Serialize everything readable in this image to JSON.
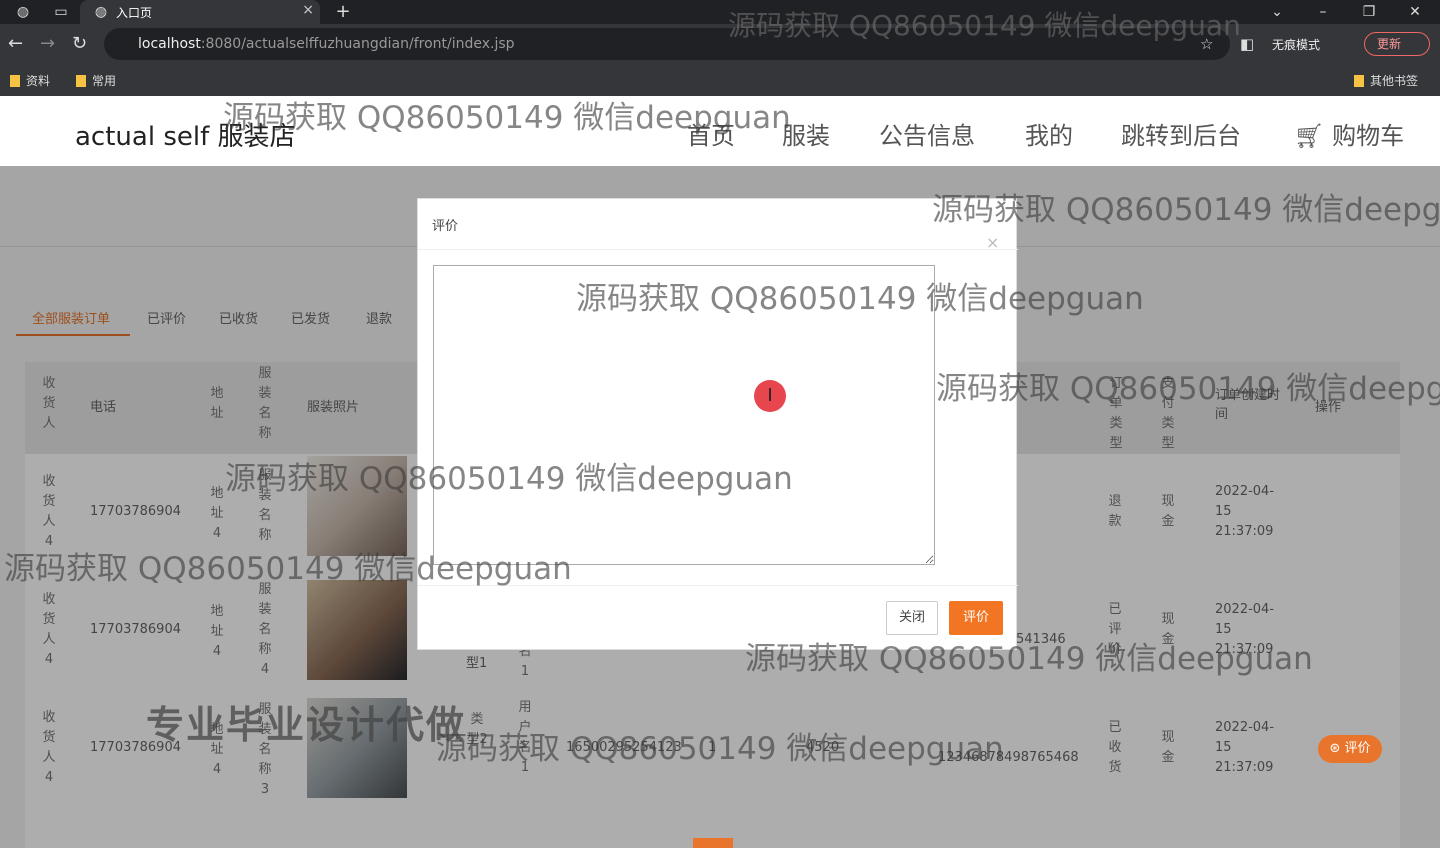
{
  "browser": {
    "tab_title": "入口页",
    "url_host": "localhost",
    "url_rest": ":8080/actualselffuzhuangdian/front/index.jsp",
    "incognito_label": "无痕模式",
    "update_label": "更新",
    "bookmarks": [
      "资料",
      "常用"
    ],
    "other_bookmarks": "其他书签"
  },
  "site": {
    "logo": "actual self 服装店",
    "nav": [
      "首页",
      "服装",
      "公告信息",
      "我的",
      "跳转到后台",
      "购物车"
    ]
  },
  "order_tabs": [
    "全部服装订单",
    "已评价",
    "已收货",
    "已发货",
    "退款"
  ],
  "table": {
    "headers": {
      "receiver": "收货人",
      "phone": "电话",
      "address": "地址",
      "name": "服装名称",
      "photo": "服装照片",
      "status": "订单类型",
      "pay": "支付类型",
      "created": "订单创建时间",
      "ops": "操作"
    },
    "rows": [
      {
        "receiver": "收货人4",
        "phone": "17703786904",
        "address": "地址4",
        "name": "服装名称",
        "status": "退款",
        "pay": "现金",
        "created": "2022-04-15 21:37:09"
      },
      {
        "receiver": "收货人4",
        "phone": "17703786904",
        "address": "地址4",
        "name": "服装名称4",
        "status": "已评价",
        "pay": "现金",
        "created": "2022-04-15 21:37:09",
        "type": "型1",
        "shop": "名1",
        "order_tail": "541346"
      },
      {
        "receiver": "收货人4",
        "phone": "17703786904",
        "address": "地址4",
        "name": "服装名称3",
        "status": "已收货",
        "pay": "现金",
        "created": "2022-04-15 21:37:09",
        "type": "类型2",
        "shop": "用户名1",
        "phone2": "16500295254123",
        "qty": "1",
        "price": "4520",
        "order_no": "12346878498765468",
        "op": "评价"
      }
    ]
  },
  "modal": {
    "title": "评价",
    "close": "×",
    "cancel": "关闭",
    "submit": "评价"
  },
  "watermarks": {
    "text": "源码获取 QQ86050149 微信deepguan",
    "big": "专业毕业设计代做"
  }
}
